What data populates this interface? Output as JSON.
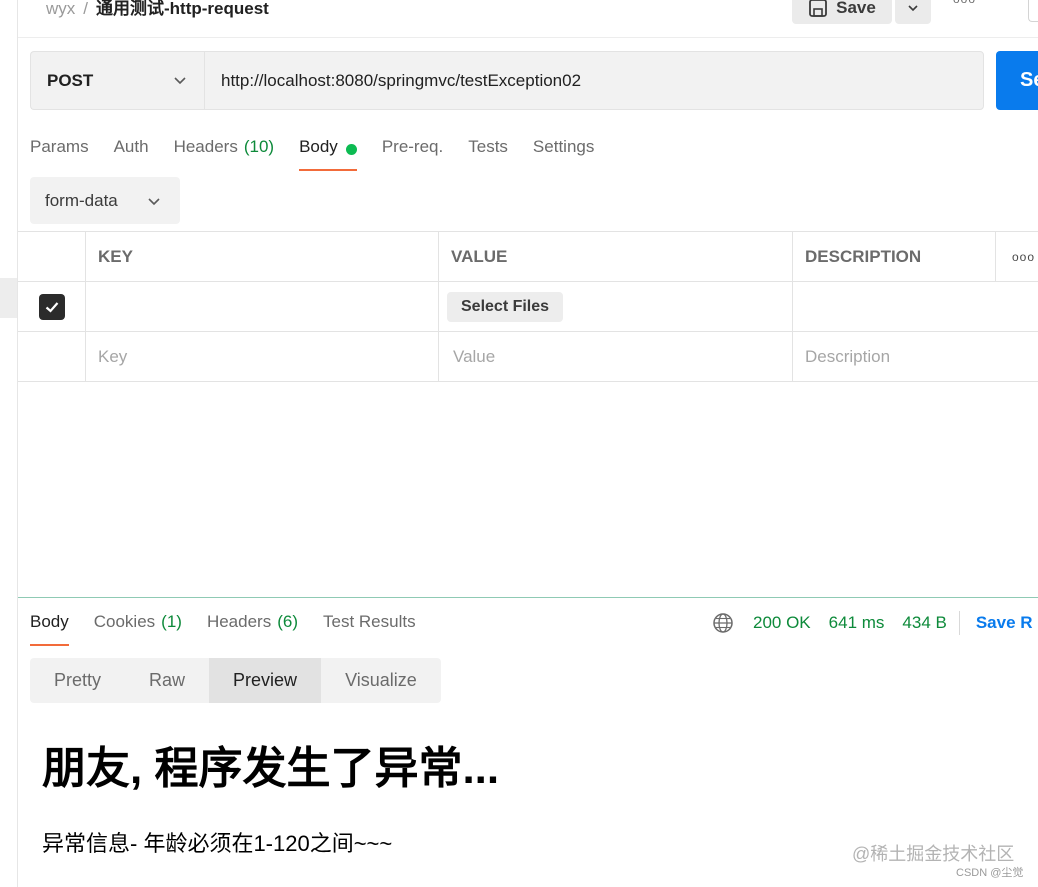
{
  "header": {
    "workspace": "wyx",
    "separator": "/",
    "request_name": "通用测试-http-request",
    "save_label": "Save",
    "more_label": "ooo"
  },
  "request": {
    "method": "POST",
    "url": "http://localhost:8080/springmvc/testException02",
    "send_label": "Se"
  },
  "request_tabs": [
    {
      "label": "Params"
    },
    {
      "label": "Auth"
    },
    {
      "label": "Headers",
      "count": "(10)"
    },
    {
      "label": "Body"
    },
    {
      "label": "Pre-req."
    },
    {
      "label": "Tests"
    },
    {
      "label": "Settings"
    }
  ],
  "body_mode": "form-data",
  "form_table": {
    "headers": [
      "KEY",
      "VALUE",
      "DESCRIPTION"
    ],
    "more_label": "ooo",
    "row1": {
      "select_files_label": "Select Files"
    },
    "row2": {
      "key_placeholder": "Key",
      "value_placeholder": "Value",
      "description_placeholder": "Description"
    }
  },
  "response": {
    "tabs": [
      {
        "label": "Body"
      },
      {
        "label": "Cookies",
        "count": "(1)"
      },
      {
        "label": "Headers",
        "count": "(6)"
      },
      {
        "label": "Test Results"
      }
    ],
    "status": "200 OK",
    "time": "641 ms",
    "size": "434 B",
    "save_label": "Save R",
    "view_modes": [
      "Pretty",
      "Raw",
      "Preview",
      "Visualize"
    ],
    "preview": {
      "title": "朋友, 程序发生了异常...",
      "message": "异常信息- 年龄必须在1-120之间~~~"
    }
  },
  "watermark": "@稀土掘金技术社区",
  "csdn_credit": "CSDN @尘觉",
  "colors": {
    "send_button": "#097bed",
    "active_tab_underline": "#f26b3a",
    "count_green": "#0d8a3a",
    "body_dot": "#0cbb52"
  }
}
